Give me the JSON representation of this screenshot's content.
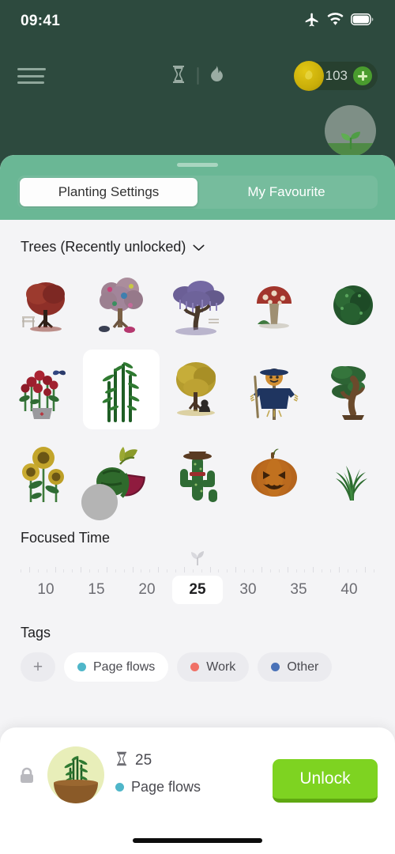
{
  "status_bar": {
    "time": "09:41",
    "icons": [
      "airplane-icon",
      "wifi-icon",
      "battery-icon"
    ]
  },
  "top_bar": {
    "menu_icon": "hamburger-menu-icon",
    "timer_icon": "hourglass-icon",
    "streak_icon": "flame-icon",
    "coin_count": "103",
    "add_coin_label": "+",
    "sprout_button_icon": "sprout-icon",
    "ghost_text": ""
  },
  "tabs": {
    "items": [
      {
        "label": "Planting Settings",
        "active": true
      },
      {
        "label": "My Favourite",
        "active": false
      }
    ]
  },
  "trees": {
    "section_label": "Trees (Recently unlocked)",
    "chevron_icon": "chevron-down-icon",
    "items": [
      {
        "name": "red-maple-tree",
        "selected": false
      },
      {
        "name": "candy-blossom-tree",
        "selected": false
      },
      {
        "name": "wisteria-tree",
        "selected": false
      },
      {
        "name": "red-mushroom",
        "selected": false
      },
      {
        "name": "round-bush",
        "selected": false
      },
      {
        "name": "rose-pot",
        "selected": false
      },
      {
        "name": "bamboo",
        "selected": true
      },
      {
        "name": "golden-ginkgo-tree",
        "selected": false
      },
      {
        "name": "scarecrow",
        "selected": false
      },
      {
        "name": "bonsai-tree",
        "selected": false
      },
      {
        "name": "sunflower",
        "selected": false
      },
      {
        "name": "watermelon",
        "selected": false
      },
      {
        "name": "cowboy-cactus",
        "selected": false
      },
      {
        "name": "jack-o-lantern",
        "selected": false
      },
      {
        "name": "grass-tuft",
        "selected": false
      }
    ]
  },
  "focused_time": {
    "title": "Focused Time",
    "marker_icon": "sprout-marker-icon",
    "options": [
      "10",
      "15",
      "20",
      "25",
      "30",
      "35",
      "40"
    ],
    "selected": "25"
  },
  "tags": {
    "title": "Tags",
    "add_label": "+",
    "items": [
      {
        "label": "Page flows",
        "color": "#4fb6c9",
        "selected": true
      },
      {
        "label": "Work",
        "color": "#f07167",
        "selected": false
      },
      {
        "label": "Other",
        "color": "#4a72b8",
        "selected": false
      }
    ]
  },
  "bottom_bar": {
    "lock_icon": "lock-icon",
    "preview_icon": "bamboo-pot-icon",
    "duration_icon": "hourglass-icon",
    "duration": "25",
    "tag_label": "Page flows",
    "tag_color": "#4fb6c9",
    "unlock_label": "Unlock"
  },
  "colors": {
    "app_background": "#2d4a3e",
    "tab_bar": "#6ab795",
    "sheet_background": "#f4f4f6",
    "unlock_green": "#7ed321",
    "coin_gold": "#c9ae09"
  }
}
